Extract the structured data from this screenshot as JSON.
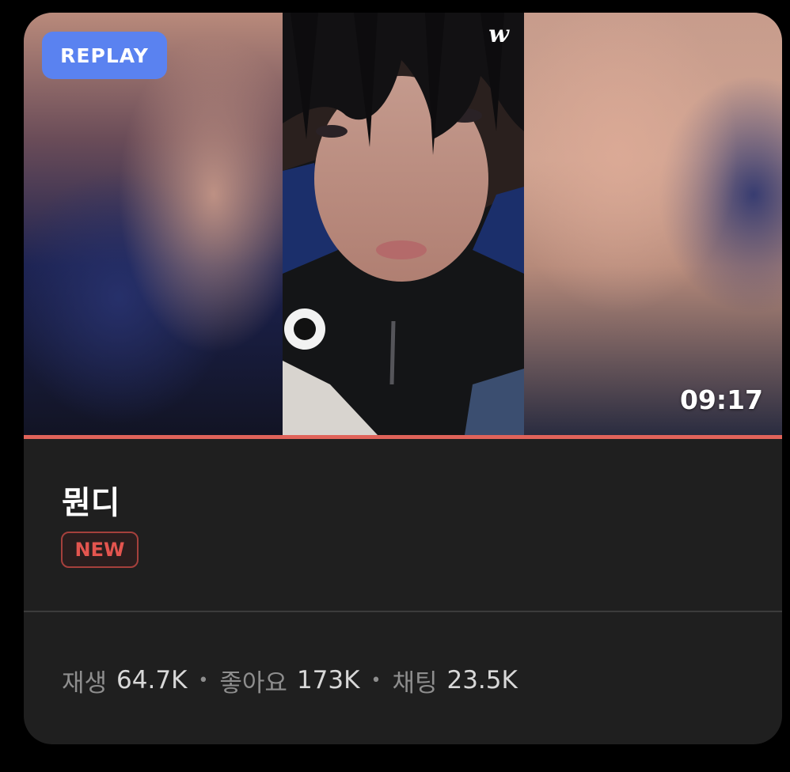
{
  "video": {
    "replay_label": "REPLAY",
    "logo_text": "w",
    "duration": "09:17",
    "progress": 1.0
  },
  "post": {
    "title": "뭔디",
    "badge": "NEW"
  },
  "stats": {
    "plays_label": "재생",
    "plays_value": "64.7K",
    "likes_label": "좋아요",
    "likes_value": "173K",
    "chats_label": "채팅",
    "chats_value": "23.5K"
  },
  "colors": {
    "replay_badge": "#5a82f0",
    "progress_bar": "#e0635a",
    "new_badge": "#e4554f",
    "card_background": "#1f1f1f"
  },
  "icons": {
    "logo": "weverse-w-logo"
  }
}
